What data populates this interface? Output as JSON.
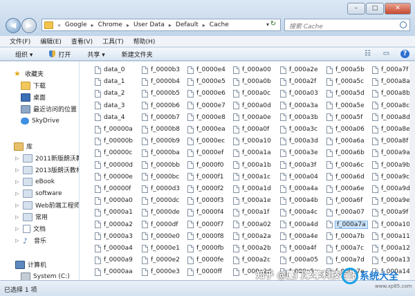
{
  "window": {
    "controls": {
      "minimize": "–",
      "maximize": "□",
      "close": "✕"
    }
  },
  "address": {
    "prefix": "«",
    "crumbs": [
      "Google",
      "Chrome",
      "User Data",
      "Default",
      "Cache"
    ],
    "dropdown": "▾",
    "refresh": "↻"
  },
  "search": {
    "placeholder": "搜索 Cache"
  },
  "menu": [
    "文件(F)",
    "编辑(E)",
    "查看(V)",
    "工具(T)",
    "帮助(H)"
  ],
  "toolbar": {
    "organize": "组织 ▾",
    "open": "打开",
    "share": "共享 ▾",
    "new_folder": "新建文件夹"
  },
  "navpane": {
    "favorites": "收藏夹",
    "downloads": "下载",
    "desktop": "桌面",
    "recent": "最近访问的位置",
    "skydrive": "SkyDrive",
    "library": "库",
    "lib_items": [
      "2011新版朗沃教",
      "2013版朗沃教材",
      "eBook",
      "software",
      "Web前端工程师",
      "常用",
      "文档",
      "音乐"
    ],
    "computer": "计算机",
    "drive": "System (C:)"
  },
  "files": {
    "col1": [
      "data_0",
      "data_1",
      "data_2",
      "data_3",
      "data_4",
      "f_00000a",
      "f_00000b",
      "f_00000c",
      "f_00000d",
      "f_00000e",
      "f_00000f",
      "f_0000a0",
      "f_0000a1",
      "f_0000a2",
      "f_0000a3",
      "f_0000a4",
      "f_0000a9",
      "f_0000aa"
    ],
    "col2": [
      "f_0000b3",
      "f_0000b4",
      "f_0000b5",
      "f_0000b6",
      "f_0000b7",
      "f_0000b8",
      "f_0000b9",
      "f_0000ba",
      "f_0000bb",
      "f_0000bc",
      "f_0000d3",
      "f_0000dc",
      "f_0000de",
      "f_0000df",
      "f_0000e0",
      "f_0000e1",
      "f_0000e2",
      "f_0000e3"
    ],
    "col3": [
      "f_0000e4",
      "f_0000e5",
      "f_0000e6",
      "f_0000e7",
      "f_0000e8",
      "f_0000ea",
      "f_0000ec",
      "f_0000ef",
      "f_0000f0",
      "f_0000f1",
      "f_0000f2",
      "f_0000f3",
      "f_0000f4",
      "f_0000f7",
      "f_0000f8",
      "f_0000fb",
      "f_0000fe",
      "f_0000ff"
    ],
    "col4": [
      "f_000a00",
      "f_000a0b",
      "f_000a0c",
      "f_000a0d",
      "f_000a0e",
      "f_000a0f",
      "f_000a10",
      "f_000a1a",
      "f_000a1b",
      "f_000a1c",
      "f_000a1d",
      "f_000a1e",
      "f_000a1f",
      "f_000a02",
      "f_000a2a",
      "f_000a2b",
      "f_000a2c",
      "f_000a2d"
    ],
    "col5": [
      "f_000a2e",
      "f_000a2f",
      "f_000a03",
      "f_000a3a",
      "f_000a3b",
      "f_000a3c",
      "f_000a3d",
      "f_000a3e",
      "f_000a3f",
      "f_000a04",
      "f_000a4a",
      "f_000a4b",
      "f_000a4c",
      "f_000a4d",
      "f_000a4e",
      "f_000a4f",
      "f_000a05",
      "f_000a5a"
    ],
    "col6": [
      "f_000a5b",
      "f_000a5c",
      "f_000a5d",
      "f_000a5e",
      "f_000a5f",
      "f_000a06",
      "f_000a6a",
      "f_000a6b",
      "f_000a6c",
      "f_000a6d",
      "f_000a6e",
      "f_000a6f",
      "f_000a07",
      "f_000a7a",
      "f_000a7b",
      "f_000a7c",
      "f_000a7d",
      "f_000a7e"
    ],
    "col7": [
      "f_000a7f",
      "f_000a8a",
      "f_000a8b",
      "f_000a8c",
      "f_000a8d",
      "f_000a8e",
      "f_000a8f",
      "f_000a9a",
      "f_000a9b",
      "f_000a9c",
      "f_000a9d",
      "f_000a9e",
      "f_000a9f",
      "f_000a10",
      "f_000a11",
      "f_000a12",
      "f_000a13",
      "f_000a14"
    ],
    "selected": "f_000a7a"
  },
  "status": {
    "text": "已选择 1 项"
  },
  "watermark": {
    "text": "知乎 @厦门掌擎科技有限",
    "brand": "系统大全",
    "url": "www.xp85.com"
  }
}
